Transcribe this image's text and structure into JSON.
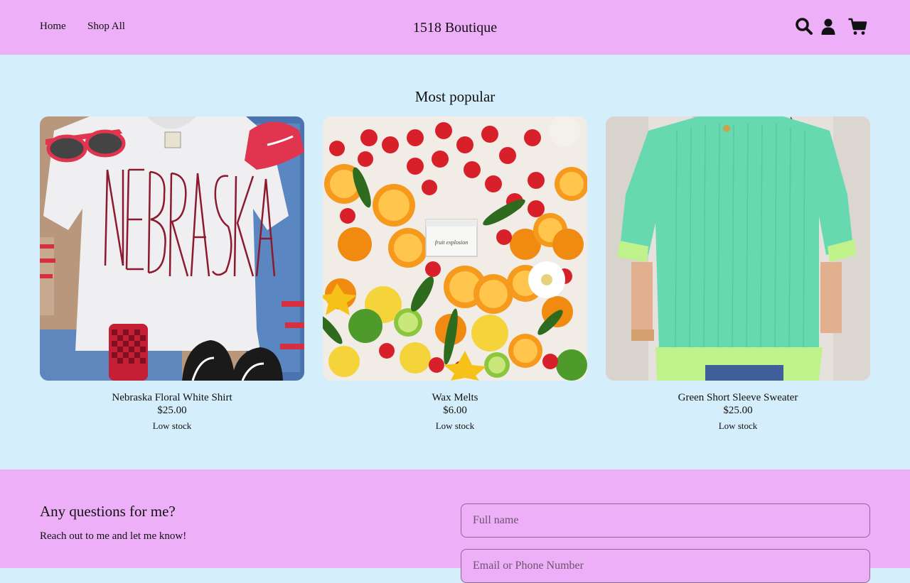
{
  "header": {
    "nav": [
      "Home",
      "Shop All"
    ],
    "brand": "1518 Boutique",
    "icons": [
      "search-icon",
      "account-icon",
      "cart-icon"
    ]
  },
  "main": {
    "section_title": "Most popular",
    "products": [
      {
        "title": "Nebraska Floral White Shirt",
        "price": "$25.00",
        "stock": "Low stock",
        "image_text": "NEBRASKA"
      },
      {
        "title": "Wax Melts",
        "price": "$6.00",
        "stock": "Low stock",
        "image_text": "fruit explosion"
      },
      {
        "title": "Green Short Sleeve Sweater",
        "price": "$25.00",
        "stock": "Low stock"
      }
    ]
  },
  "contact": {
    "title": "Any questions for me?",
    "subtitle": "Reach out to me and let me know!",
    "name_placeholder": "Full name",
    "contact_placeholder": "Email or Phone Number"
  },
  "colors": {
    "header_bg": "#edaff7",
    "main_bg": "#d4effb",
    "footer_bg": "#edaff7"
  }
}
